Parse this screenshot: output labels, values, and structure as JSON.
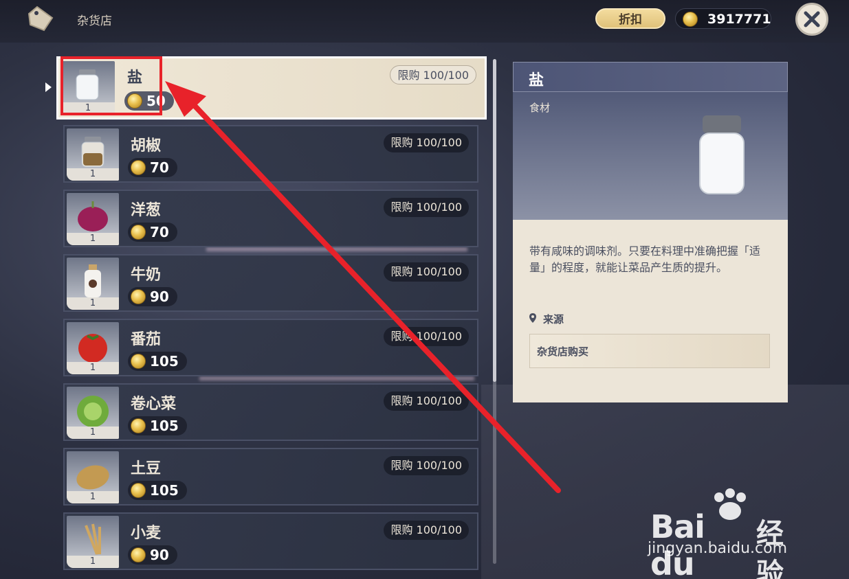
{
  "topbar": {
    "shop_icon": "tag-icon",
    "shop_title": "杂货店",
    "discount_label": "折扣",
    "mora_icon": "mora-coin-icon",
    "mora_amount": "3917771",
    "close_icon": "close-icon"
  },
  "items": [
    {
      "name": "盐",
      "price": "50",
      "limit": "限购 100/100",
      "qty": "1",
      "icon": "salt-jar-icon",
      "selected": true
    },
    {
      "name": "胡椒",
      "price": "70",
      "limit": "限购 100/100",
      "qty": "1",
      "icon": "pepper-jar-icon"
    },
    {
      "name": "洋葱",
      "price": "70",
      "limit": "限购 100/100",
      "qty": "1",
      "icon": "onion-icon"
    },
    {
      "name": "牛奶",
      "price": "90",
      "limit": "限购 100/100",
      "qty": "1",
      "icon": "milk-bottle-icon"
    },
    {
      "name": "番茄",
      "price": "105",
      "limit": "限购 100/100",
      "qty": "1",
      "icon": "tomato-icon"
    },
    {
      "name": "卷心菜",
      "price": "105",
      "limit": "限购 100/100",
      "qty": "1",
      "icon": "cabbage-icon"
    },
    {
      "name": "土豆",
      "price": "105",
      "limit": "限购 100/100",
      "qty": "1",
      "icon": "potato-icon"
    },
    {
      "name": "小麦",
      "price": "90",
      "limit": "限购 100/100",
      "qty": "1",
      "icon": "wheat-icon"
    }
  ],
  "detail": {
    "title": "盐",
    "type": "食材",
    "description": "带有咸味的调味剂。只要在料理中准确把握「适量」的程度，就能让菜品产生质的提升。",
    "source_label": "来源",
    "source_value": "杂货店购买"
  },
  "watermark": {
    "brand": "Bai du",
    "sub": "经验",
    "url": "jingyan.baidu.com"
  },
  "colors": {
    "accent_red": "#e8222a",
    "panel_light": "#ece5d8",
    "panel_dark": "#4d5576",
    "coin_gold": "#e8bf4c"
  }
}
